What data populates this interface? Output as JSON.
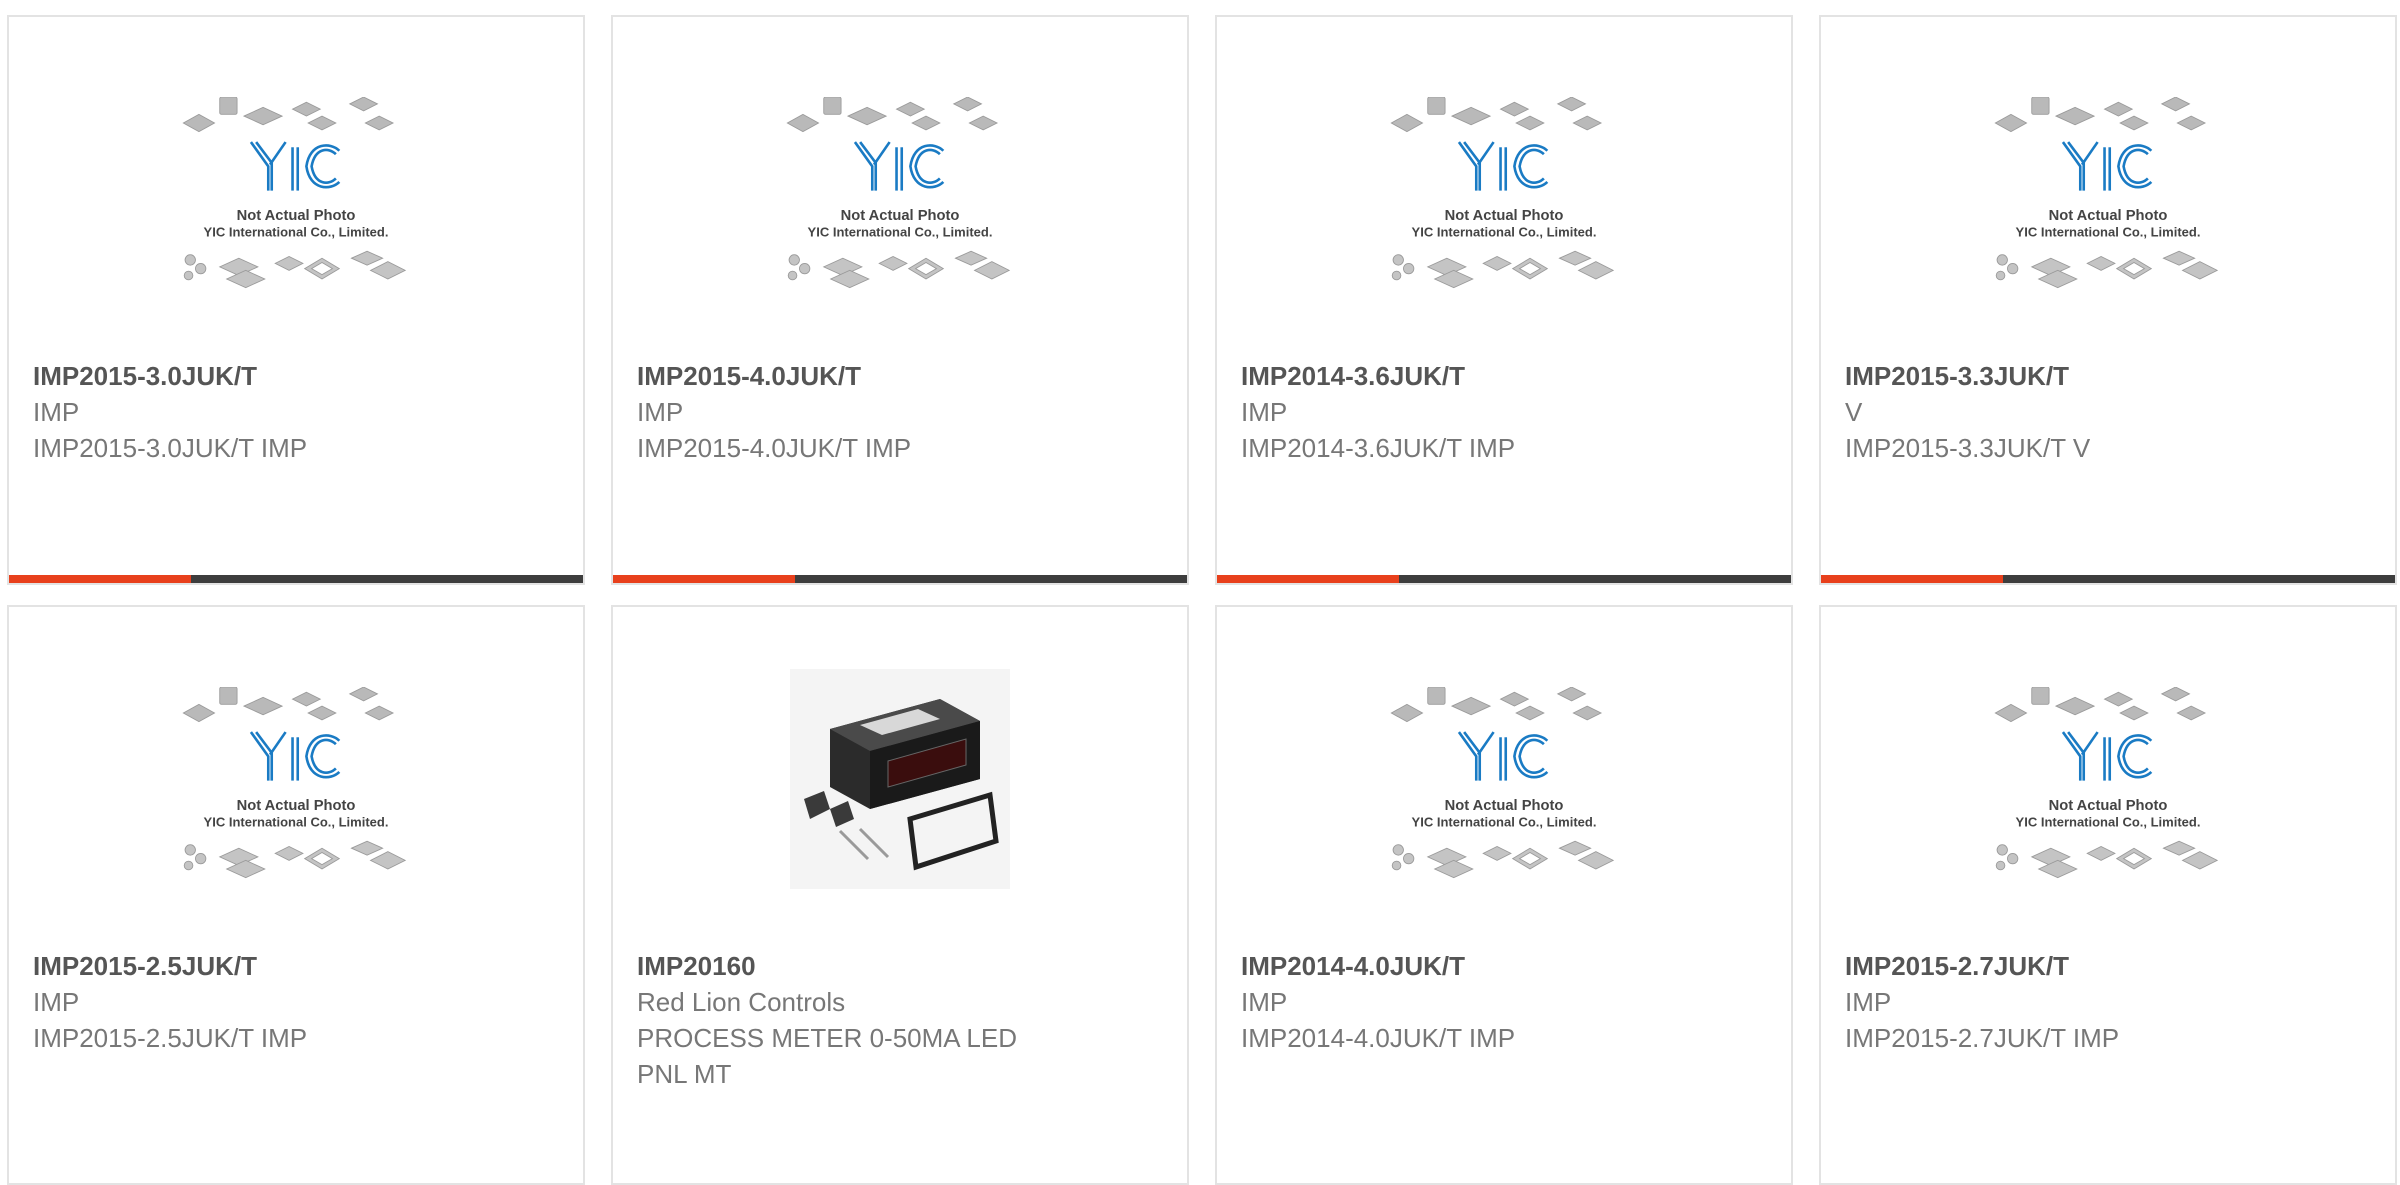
{
  "colors": {
    "accent": "#e8401c",
    "bar": "#3d3d3d",
    "logo_blue": "#1a7bc4",
    "text_dark": "#555555",
    "text_light": "#777777"
  },
  "placeholder": {
    "line1": "Not Actual Photo",
    "line2": "YIC International Co., Limited.",
    "logo_text": "YIC"
  },
  "products": [
    {
      "part": "IMP2015-3.0JUK/T",
      "manufacturer": "IMP",
      "description": "IMP2015-3.0JUK/T IMP",
      "image": "placeholder"
    },
    {
      "part": "IMP2015-4.0JUK/T",
      "manufacturer": "IMP",
      "description": "IMP2015-4.0JUK/T IMP",
      "image": "placeholder"
    },
    {
      "part": "IMP2014-3.6JUK/T",
      "manufacturer": "IMP",
      "description": "IMP2014-3.6JUK/T IMP",
      "image": "placeholder"
    },
    {
      "part": "IMP2015-3.3JUK/T",
      "manufacturer": "V",
      "description": "IMP2015-3.3JUK/T V",
      "image": "placeholder"
    },
    {
      "part": "IMP2015-2.5JUK/T",
      "manufacturer": "IMP",
      "description": "IMP2015-2.5JUK/T IMP",
      "image": "placeholder"
    },
    {
      "part": "IMP20160",
      "manufacturer": "Red Lion Controls",
      "description": "PROCESS METER 0-50MA LED PNL MT",
      "image": "process-meter-photo"
    },
    {
      "part": "IMP2014-4.0JUK/T",
      "manufacturer": "IMP",
      "description": "IMP2014-4.0JUK/T IMP",
      "image": "placeholder"
    },
    {
      "part": "IMP2015-2.7JUK/T",
      "manufacturer": "IMP",
      "description": "IMP2015-2.7JUK/T IMP",
      "image": "placeholder"
    }
  ]
}
